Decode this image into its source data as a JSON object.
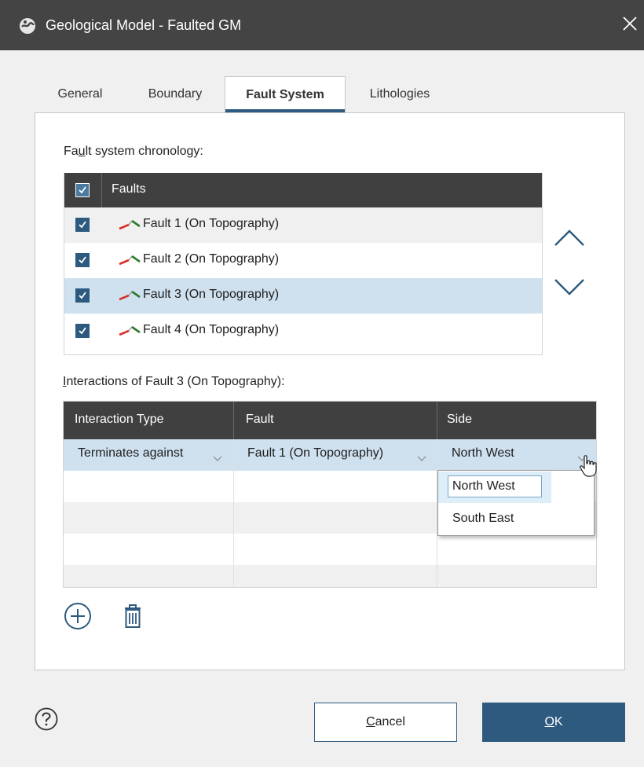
{
  "window": {
    "title": "Geological Model - Faulted GM",
    "app_icon": "geological-model-icon",
    "close_icon": "close-icon"
  },
  "tabs": [
    {
      "label": "General",
      "active": false
    },
    {
      "label": "Boundary",
      "active": false
    },
    {
      "label": "Fault System",
      "active": true
    },
    {
      "label": "Lithologies",
      "active": false
    }
  ],
  "chronology": {
    "label_pre": "Fa",
    "label_mnemonic": "u",
    "label_post": "lt system chronology:",
    "header": "Faults",
    "header_checked": true,
    "rows": [
      {
        "label": "Fault 1 (On Topography)",
        "checked": true
      },
      {
        "label": "Fault 2 (On Topography)",
        "checked": true
      },
      {
        "label": "Fault 3 (On Topography)",
        "checked": true
      },
      {
        "label": "Fault 4 (On Topography)",
        "checked": true
      }
    ],
    "selected_index": 2,
    "move_up_icon": "chevron-up-icon",
    "move_down_icon": "chevron-down-icon"
  },
  "interactions": {
    "label_mnemonic": "I",
    "label_post": "nteractions of Fault 3 (On Topography):",
    "columns": [
      "Interaction Type",
      "Fault",
      "Side"
    ],
    "rows": [
      {
        "type": "Terminates against",
        "fault": "Fault 1 (On Topography)",
        "side": "North West"
      }
    ],
    "side_options": [
      "North West",
      "South East"
    ],
    "add_icon": "add-circle-icon",
    "delete_icon": "trash-icon"
  },
  "footer": {
    "help_icon": "help-icon",
    "cancel_mnemonic": "C",
    "cancel_rest": "ancel",
    "ok_mnemonic": "O",
    "ok_rest": "K"
  },
  "colors": {
    "titlebar": "#444444",
    "accent": "#2d5a7e",
    "selected_row": "#cfe1ef",
    "grid_header": "#404040",
    "fault_icon_red": "#d9302b"
  }
}
